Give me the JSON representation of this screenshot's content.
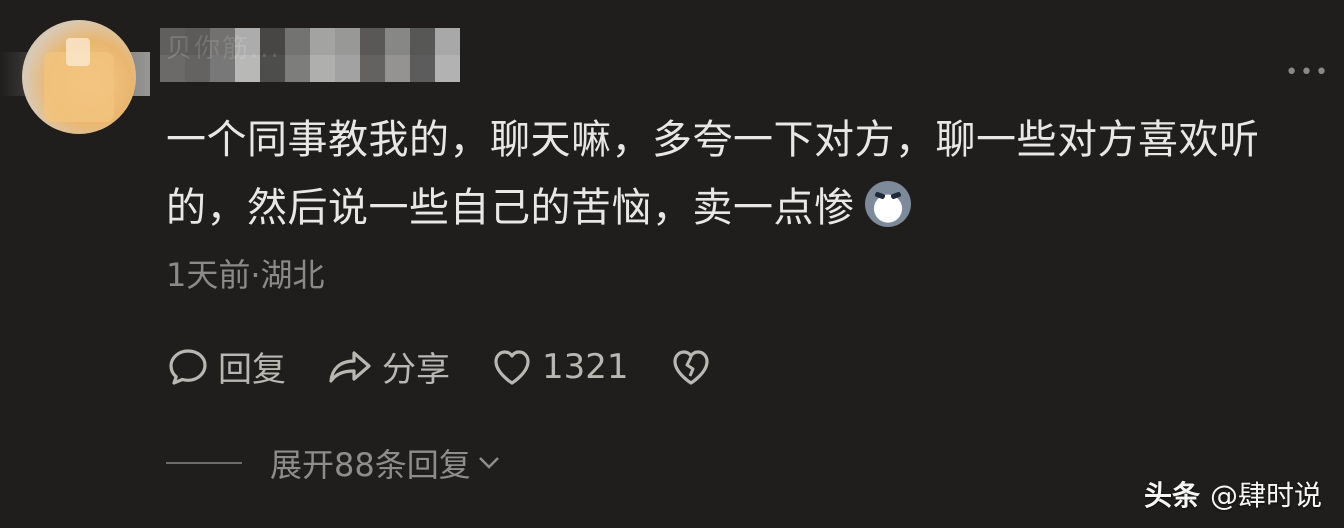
{
  "comment": {
    "username_obscured": "贝你筋...",
    "text": "一个同事教我的，聊天嘛，多夸一下对方，聊一些对方喜欢听的，然后说一些自己的苦恼，卖一点惨",
    "emoji_icon": "cool-dog-emoji-icon",
    "meta": "1天前·湖北",
    "actions": {
      "reply_label": "回复",
      "share_label": "分享",
      "like_count": "1321"
    },
    "expand_label": "展开88条回复",
    "more_icon": "more-dots-icon"
  },
  "watermark": {
    "brand": "头条",
    "author": "@肆时说"
  },
  "colors": {
    "background": "#1f1e1c",
    "text_primary": "#e9e7e3",
    "text_secondary": "#8c8a86"
  }
}
